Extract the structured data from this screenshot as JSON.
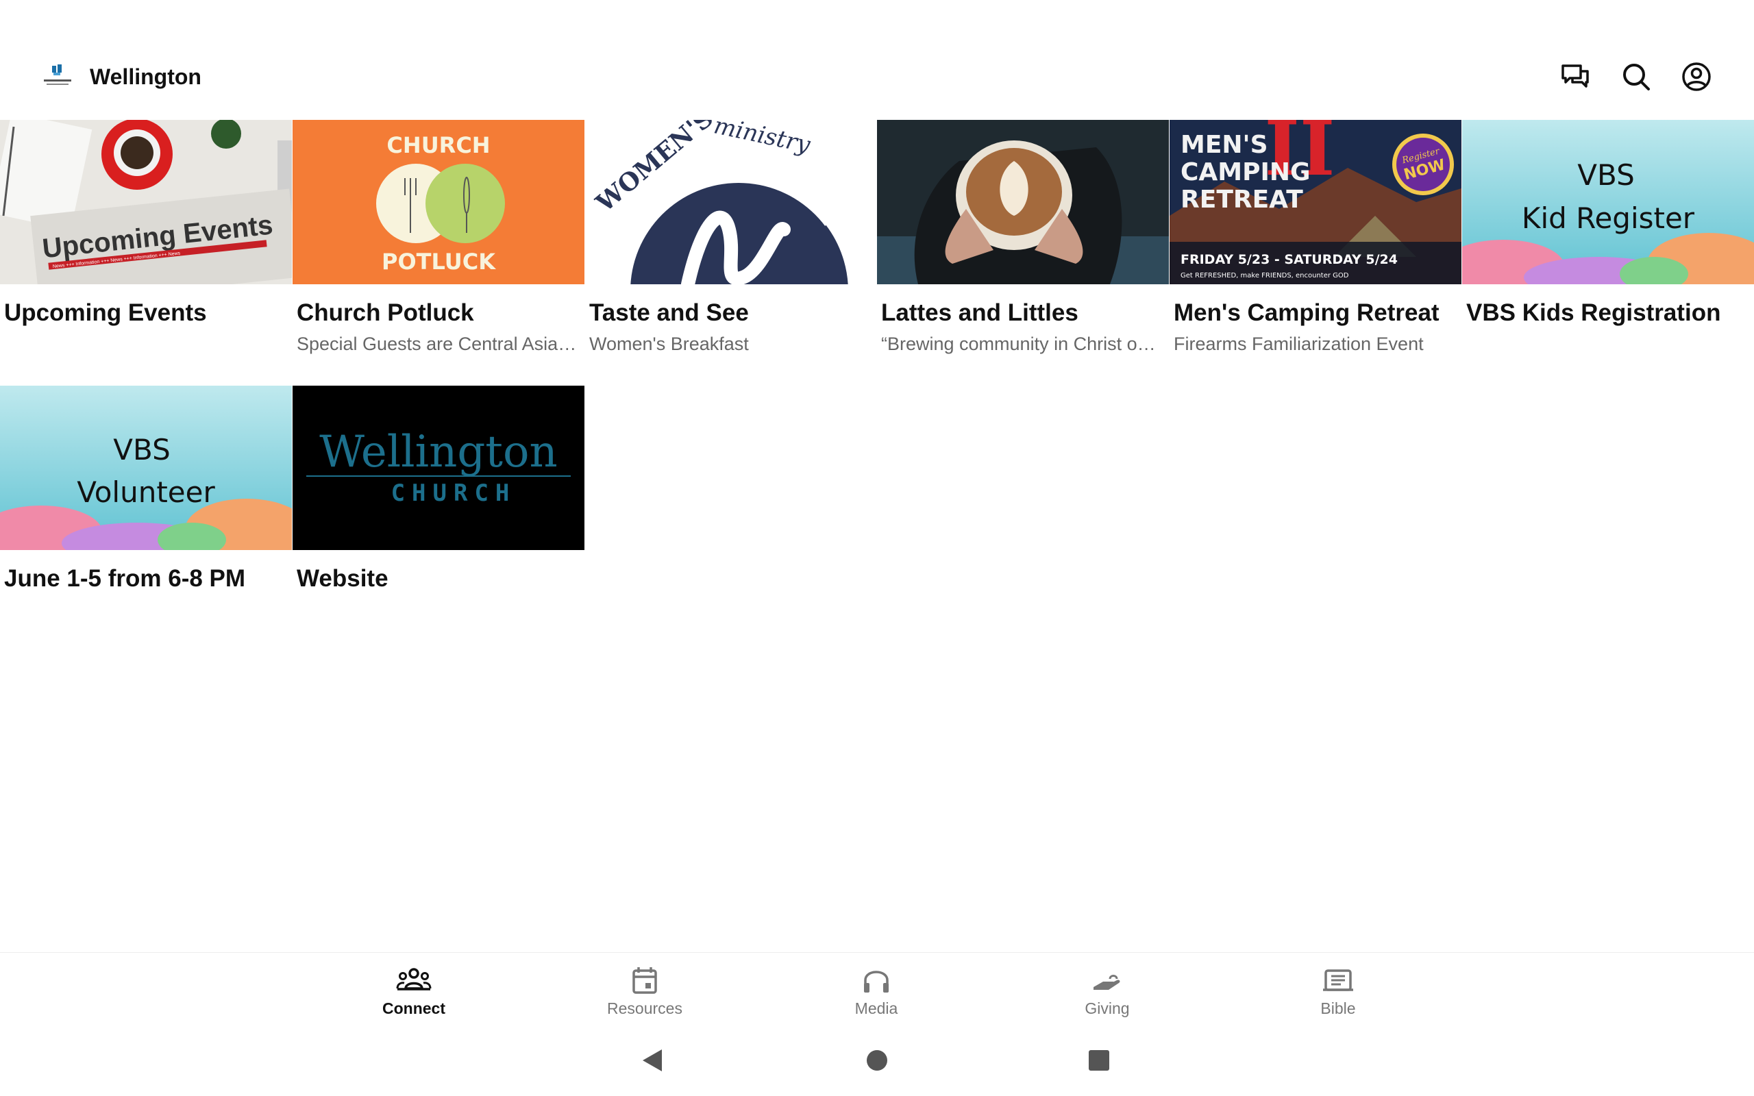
{
  "header": {
    "title": "Wellington",
    "icons": [
      "chat-icon",
      "search-icon",
      "account-icon"
    ]
  },
  "cards": [
    {
      "title": "Upcoming Events",
      "subtitle": "",
      "image_text": "Upcoming Events",
      "image_subtext": "News +++ Information +++ News +++ Information +++ News"
    },
    {
      "title": "Church Potluck",
      "subtitle": "Special Guests are Central Asia Missionaries",
      "image_text_top": "CHURCH",
      "image_text_bottom": "POTLUCK"
    },
    {
      "title": "Taste and See",
      "subtitle": "Women's Breakfast",
      "image_text_arc": "WOMEN'S",
      "image_text_script": "ministry"
    },
    {
      "title": "Lattes and Littles",
      "subtitle": "“Brewing community in Christ one latte at a time”"
    },
    {
      "title": "Men's Camping Retreat",
      "subtitle": "Firearms Familiarization Event",
      "image_line1": "MEN'S",
      "image_line2": "CAMPING",
      "image_line3": "RETREAT",
      "image_numeral": "II",
      "image_badge_top": "Register",
      "image_badge_main": "NOW",
      "image_dates": "FRIDAY 5/23 - SATURDAY 5/24",
      "image_tagline": "Get REFRESHED, make FRIENDS, encounter GOD"
    },
    {
      "title": "VBS Kids Registration",
      "subtitle": "",
      "image_line1": "VBS",
      "image_line2": "Kid Register"
    },
    {
      "title": "June 1-5 from 6-8 PM",
      "subtitle": "",
      "image_line1": "VBS",
      "image_line2": "Volunteer"
    },
    {
      "title": "Website",
      "subtitle": "",
      "image_line1": "Wellington",
      "image_line2": "CHURCH"
    }
  ],
  "bottom_nav": [
    {
      "label": "Connect",
      "icon": "group-icon",
      "active": true
    },
    {
      "label": "Resources",
      "icon": "calendar-icon",
      "active": false
    },
    {
      "label": "Media",
      "icon": "headphones-icon",
      "active": false
    },
    {
      "label": "Giving",
      "icon": "giving-hand-icon",
      "active": false
    },
    {
      "label": "Bible",
      "icon": "bible-icon",
      "active": false
    }
  ],
  "system_nav": [
    "back-icon",
    "home-icon",
    "recents-icon"
  ],
  "colors": {
    "potluck_orange": "#f47c36",
    "womens_navy": "#2a3557",
    "camping_purple": "#6a2a9a",
    "camping_red": "#d8232a",
    "website_teal": "#1c6f8c",
    "reef_water": "#7fd0dc"
  }
}
